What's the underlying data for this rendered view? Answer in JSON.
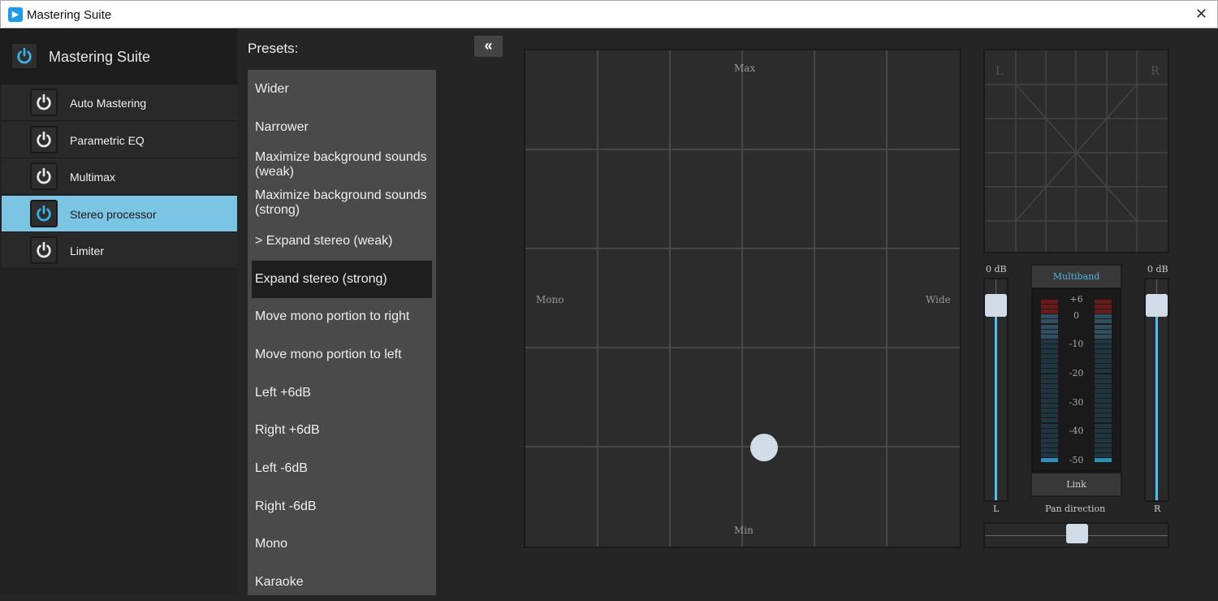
{
  "window": {
    "title": "Mastering Suite",
    "close": "✕",
    "app_icon": "app-icon"
  },
  "sidebar": {
    "header": "Mastering Suite",
    "items": [
      {
        "label": "Auto Mastering",
        "enabled": false
      },
      {
        "label": "Parametric EQ",
        "enabled": false
      },
      {
        "label": "Multimax",
        "enabled": false
      },
      {
        "label": "Stereo processor",
        "enabled": true,
        "selected": true
      },
      {
        "label": "Limiter",
        "enabled": false
      }
    ]
  },
  "presets": {
    "label": "Presets:",
    "collapse": "«",
    "items": [
      "Wider",
      "Narrower",
      "Maximize background sounds (weak)",
      "Maximize background sounds (strong)",
      "> Expand stereo (weak)",
      "Expand stereo (strong)",
      "Move mono portion to right",
      "Move mono portion to left",
      "Left +6dB",
      "Right +6dB",
      "Left -6dB",
      "Right -6dB",
      "Mono",
      "Karaoke"
    ],
    "selected_index": 5
  },
  "xypad": {
    "top": "Max",
    "bottom": "Min",
    "left": "Mono",
    "right": "Wide"
  },
  "goniometer": {
    "left": "L",
    "right": "R"
  },
  "levels": {
    "left_db": "0 dB",
    "right_db": "0 dB",
    "left_label": "L",
    "right_label": "R",
    "multiband": "Multiband",
    "link": "Link",
    "pan_label": "Pan direction",
    "scale": [
      "+6",
      "0",
      "-10",
      "-20",
      "-30",
      "-40",
      "-50"
    ]
  },
  "colors": {
    "accent": "#4fc0ee",
    "selected": "#7cc4e4"
  }
}
